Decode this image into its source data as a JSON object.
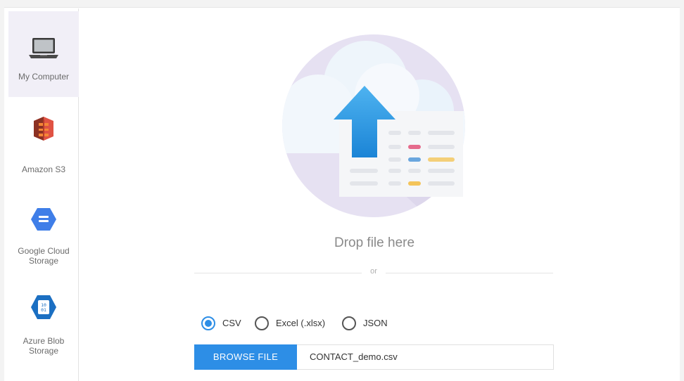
{
  "sources": [
    {
      "label": "My Computer",
      "icon": "laptop-icon",
      "active": true
    },
    {
      "label": "Amazon S3",
      "icon": "amazon-s3-icon"
    },
    {
      "label": "Google Cloud Storage",
      "icon": "google-cloud-storage-icon"
    },
    {
      "label": "Azure Blob Storage",
      "icon": "azure-blob-storage-icon"
    }
  ],
  "dropzone": {
    "text": "Drop file here",
    "or": "or"
  },
  "formats": {
    "options": [
      "CSV",
      "Excel (.xlsx)",
      "JSON"
    ],
    "selected": "CSV"
  },
  "browse": {
    "button_label": "BROWSE FILE",
    "filename": "CONTACT_demo.csv"
  },
  "colors": {
    "accent": "#2d8ee6",
    "active_source_bg": "#f1eff7",
    "s3_red": "#d13a25",
    "gcs_blue": "#3f7ee8"
  }
}
